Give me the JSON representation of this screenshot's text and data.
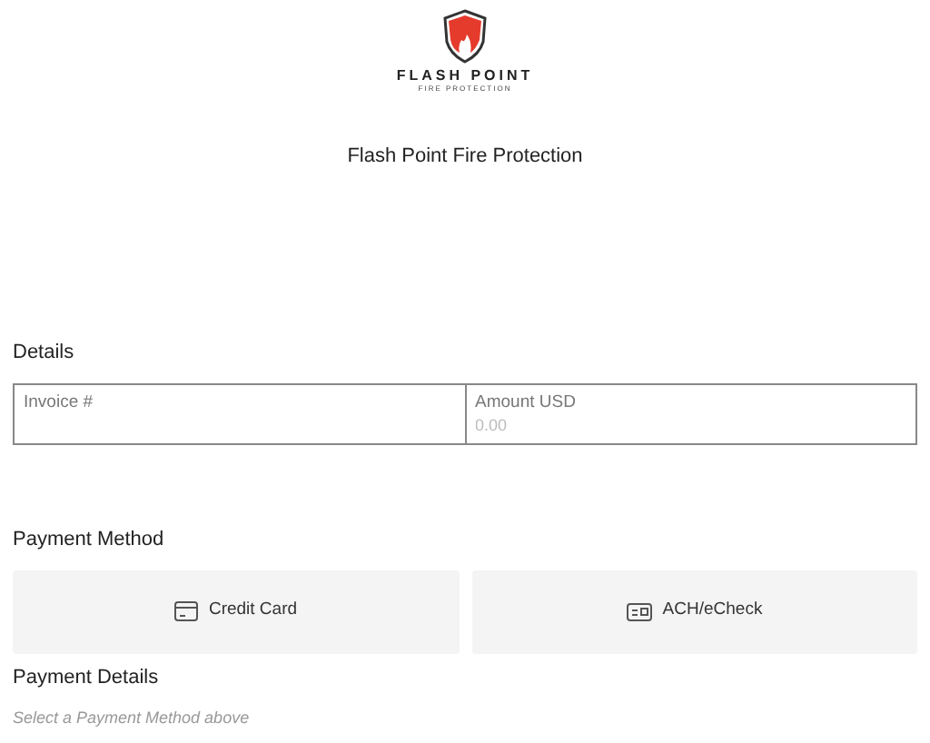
{
  "logo": {
    "name": "FLASH POINT",
    "tagline": "FIRE PROTECTION"
  },
  "company": "Flash Point Fire Protection",
  "details": {
    "heading": "Details",
    "fields": [
      {
        "label": "Invoice #"
      },
      {
        "label": "Amount USD",
        "placeholder": "0.00"
      }
    ]
  },
  "payment_method": {
    "heading": "Payment Method",
    "options": [
      {
        "kind": "card",
        "label": "Credit Card"
      },
      {
        "kind": "check",
        "label": "ACH/eCheck"
      }
    ]
  },
  "payment_details": {
    "heading": "Payment Details",
    "hint": "Select a Payment Method above"
  }
}
